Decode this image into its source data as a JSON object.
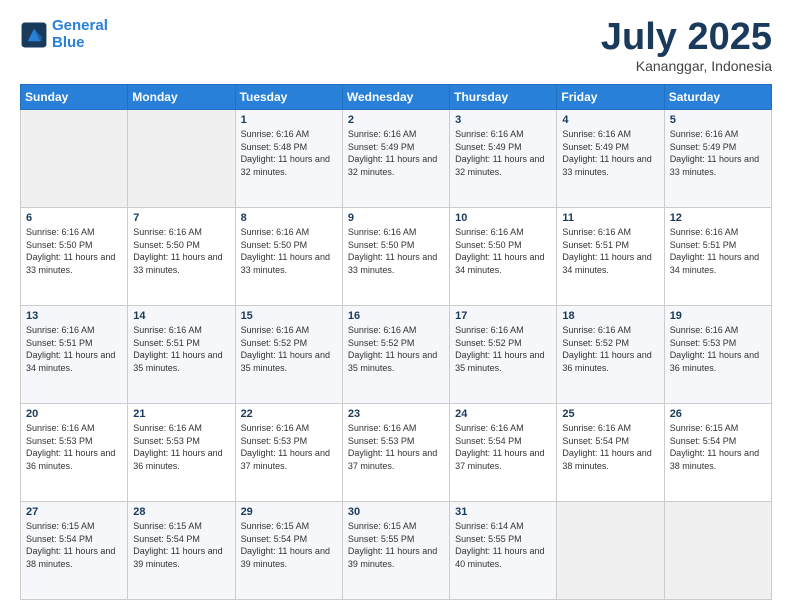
{
  "header": {
    "logo_line1": "General",
    "logo_line2": "Blue",
    "month": "July 2025",
    "location": "Kananggar, Indonesia"
  },
  "days_of_week": [
    "Sunday",
    "Monday",
    "Tuesday",
    "Wednesday",
    "Thursday",
    "Friday",
    "Saturday"
  ],
  "weeks": [
    [
      {
        "day": "",
        "empty": true
      },
      {
        "day": "",
        "empty": true
      },
      {
        "day": "1",
        "sunrise": "Sunrise: 6:16 AM",
        "sunset": "Sunset: 5:48 PM",
        "daylight": "Daylight: 11 hours and 32 minutes."
      },
      {
        "day": "2",
        "sunrise": "Sunrise: 6:16 AM",
        "sunset": "Sunset: 5:49 PM",
        "daylight": "Daylight: 11 hours and 32 minutes."
      },
      {
        "day": "3",
        "sunrise": "Sunrise: 6:16 AM",
        "sunset": "Sunset: 5:49 PM",
        "daylight": "Daylight: 11 hours and 32 minutes."
      },
      {
        "day": "4",
        "sunrise": "Sunrise: 6:16 AM",
        "sunset": "Sunset: 5:49 PM",
        "daylight": "Daylight: 11 hours and 33 minutes."
      },
      {
        "day": "5",
        "sunrise": "Sunrise: 6:16 AM",
        "sunset": "Sunset: 5:49 PM",
        "daylight": "Daylight: 11 hours and 33 minutes."
      }
    ],
    [
      {
        "day": "6",
        "sunrise": "Sunrise: 6:16 AM",
        "sunset": "Sunset: 5:50 PM",
        "daylight": "Daylight: 11 hours and 33 minutes."
      },
      {
        "day": "7",
        "sunrise": "Sunrise: 6:16 AM",
        "sunset": "Sunset: 5:50 PM",
        "daylight": "Daylight: 11 hours and 33 minutes."
      },
      {
        "day": "8",
        "sunrise": "Sunrise: 6:16 AM",
        "sunset": "Sunset: 5:50 PM",
        "daylight": "Daylight: 11 hours and 33 minutes."
      },
      {
        "day": "9",
        "sunrise": "Sunrise: 6:16 AM",
        "sunset": "Sunset: 5:50 PM",
        "daylight": "Daylight: 11 hours and 33 minutes."
      },
      {
        "day": "10",
        "sunrise": "Sunrise: 6:16 AM",
        "sunset": "Sunset: 5:50 PM",
        "daylight": "Daylight: 11 hours and 34 minutes."
      },
      {
        "day": "11",
        "sunrise": "Sunrise: 6:16 AM",
        "sunset": "Sunset: 5:51 PM",
        "daylight": "Daylight: 11 hours and 34 minutes."
      },
      {
        "day": "12",
        "sunrise": "Sunrise: 6:16 AM",
        "sunset": "Sunset: 5:51 PM",
        "daylight": "Daylight: 11 hours and 34 minutes."
      }
    ],
    [
      {
        "day": "13",
        "sunrise": "Sunrise: 6:16 AM",
        "sunset": "Sunset: 5:51 PM",
        "daylight": "Daylight: 11 hours and 34 minutes."
      },
      {
        "day": "14",
        "sunrise": "Sunrise: 6:16 AM",
        "sunset": "Sunset: 5:51 PM",
        "daylight": "Daylight: 11 hours and 35 minutes."
      },
      {
        "day": "15",
        "sunrise": "Sunrise: 6:16 AM",
        "sunset": "Sunset: 5:52 PM",
        "daylight": "Daylight: 11 hours and 35 minutes."
      },
      {
        "day": "16",
        "sunrise": "Sunrise: 6:16 AM",
        "sunset": "Sunset: 5:52 PM",
        "daylight": "Daylight: 11 hours and 35 minutes."
      },
      {
        "day": "17",
        "sunrise": "Sunrise: 6:16 AM",
        "sunset": "Sunset: 5:52 PM",
        "daylight": "Daylight: 11 hours and 35 minutes."
      },
      {
        "day": "18",
        "sunrise": "Sunrise: 6:16 AM",
        "sunset": "Sunset: 5:52 PM",
        "daylight": "Daylight: 11 hours and 36 minutes."
      },
      {
        "day": "19",
        "sunrise": "Sunrise: 6:16 AM",
        "sunset": "Sunset: 5:53 PM",
        "daylight": "Daylight: 11 hours and 36 minutes."
      }
    ],
    [
      {
        "day": "20",
        "sunrise": "Sunrise: 6:16 AM",
        "sunset": "Sunset: 5:53 PM",
        "daylight": "Daylight: 11 hours and 36 minutes."
      },
      {
        "day": "21",
        "sunrise": "Sunrise: 6:16 AM",
        "sunset": "Sunset: 5:53 PM",
        "daylight": "Daylight: 11 hours and 36 minutes."
      },
      {
        "day": "22",
        "sunrise": "Sunrise: 6:16 AM",
        "sunset": "Sunset: 5:53 PM",
        "daylight": "Daylight: 11 hours and 37 minutes."
      },
      {
        "day": "23",
        "sunrise": "Sunrise: 6:16 AM",
        "sunset": "Sunset: 5:53 PM",
        "daylight": "Daylight: 11 hours and 37 minutes."
      },
      {
        "day": "24",
        "sunrise": "Sunrise: 6:16 AM",
        "sunset": "Sunset: 5:54 PM",
        "daylight": "Daylight: 11 hours and 37 minutes."
      },
      {
        "day": "25",
        "sunrise": "Sunrise: 6:16 AM",
        "sunset": "Sunset: 5:54 PM",
        "daylight": "Daylight: 11 hours and 38 minutes."
      },
      {
        "day": "26",
        "sunrise": "Sunrise: 6:15 AM",
        "sunset": "Sunset: 5:54 PM",
        "daylight": "Daylight: 11 hours and 38 minutes."
      }
    ],
    [
      {
        "day": "27",
        "sunrise": "Sunrise: 6:15 AM",
        "sunset": "Sunset: 5:54 PM",
        "daylight": "Daylight: 11 hours and 38 minutes."
      },
      {
        "day": "28",
        "sunrise": "Sunrise: 6:15 AM",
        "sunset": "Sunset: 5:54 PM",
        "daylight": "Daylight: 11 hours and 39 minutes."
      },
      {
        "day": "29",
        "sunrise": "Sunrise: 6:15 AM",
        "sunset": "Sunset: 5:54 PM",
        "daylight": "Daylight: 11 hours and 39 minutes."
      },
      {
        "day": "30",
        "sunrise": "Sunrise: 6:15 AM",
        "sunset": "Sunset: 5:55 PM",
        "daylight": "Daylight: 11 hours and 39 minutes."
      },
      {
        "day": "31",
        "sunrise": "Sunrise: 6:14 AM",
        "sunset": "Sunset: 5:55 PM",
        "daylight": "Daylight: 11 hours and 40 minutes."
      },
      {
        "day": "",
        "empty": true
      },
      {
        "day": "",
        "empty": true
      }
    ]
  ]
}
